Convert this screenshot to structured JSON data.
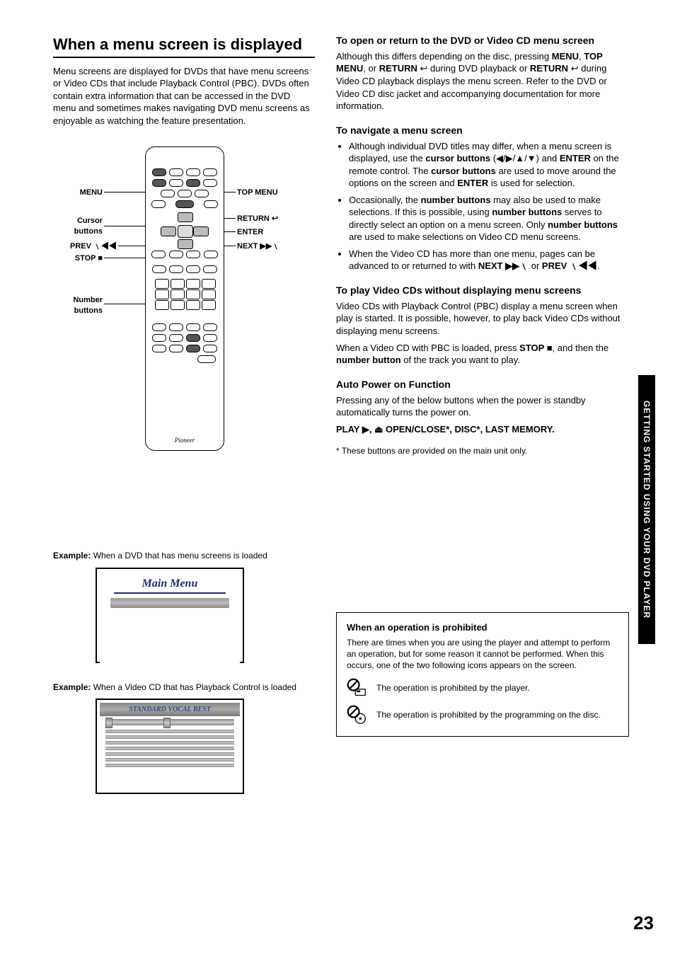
{
  "left": {
    "heading": "When a menu screen is displayed",
    "intro": "Menu screens are displayed for DVDs that have menu screens or Video CDs that include Playback Control (PBC). DVDs often contain extra information that can be accessed in the DVD menu and sometimes makes navigating DVD menu screens as enjoyable as watching the feature presentation.",
    "callouts": {
      "menu": "MENU",
      "cursor": "Cursor\nbuttons",
      "prev": "PREV ﹨◀◀",
      "stop": "STOP ■",
      "numbers": "Number\nbuttons",
      "topmenu": "TOP MENU",
      "return": "RETURN",
      "enter": "ENTER",
      "next": "NEXT ▶▶﹨"
    },
    "brand": "Pioneer",
    "example1_label_bold": "Example:",
    "example1_label_rest": " When a DVD that has menu screens is loaded",
    "mainmenu_title": "Main Menu",
    "example2_label_bold": "Example:",
    "example2_label_rest": " When a Video CD that has Playback Control is loaded",
    "vcd_title": "STANDARD VOCAL BEST"
  },
  "right": {
    "sec1_head": "To open or return to the DVD or Video CD menu screen",
    "sec1_p1a": "Although this differs depending on the disc, pressing ",
    "sec1_menu": "MENU",
    "sec1_p1b": ", ",
    "sec1_topmenu": "TOP MENU",
    "sec1_p1c": ", or ",
    "sec1_return": "RETURN",
    "sec1_p1d": " during DVD playback or ",
    "sec1_return2": "RETURN",
    "sec1_p1e": " during Video CD playback displays the menu screen. Refer to the DVD or Video CD disc jacket and accompanying documentation for more information.",
    "sec2_head": "To navigate a menu screen",
    "sec2_li1a": "Although individual DVD titles may differ, when a menu screen is displayed, use the ",
    "sec2_li1_cb": "cursor buttons",
    "sec2_li1b": " (◀/▶/▲/▼) and ",
    "sec2_li1_enter": "ENTER",
    "sec2_li1c": " on the remote control. The ",
    "sec2_li1_cb2": "cursor buttons",
    "sec2_li1d": " are used to move around the options on the screen and ",
    "sec2_li1_enter2": "ENTER",
    "sec2_li1e": " is used for selection.",
    "sec2_li2a": "Occasionally, the ",
    "sec2_li2_nb": "number buttons",
    "sec2_li2b": " may also be used to make selections. If this is possible, using ",
    "sec2_li2_nb2": "number buttons",
    "sec2_li2c": " serves to directly select an option on a menu screen. Only ",
    "sec2_li2_nb3": "number buttons",
    "sec2_li2d": " are used to make selections on Video CD menu screens.",
    "sec2_li3a": "When the Video CD has more than one menu, pages can be advanced to or returned to with ",
    "sec2_li3_next": "NEXT ▶▶﹨",
    "sec2_li3b": " or ",
    "sec2_li3_prev": "PREV ﹨◀◀",
    "sec2_li3c": ".",
    "sec3_head": "To play Video CDs without displaying menu screens",
    "sec3_p1": "Video CDs with Playback Control (PBC) display a menu screen when play is started. It is possible, however, to play back Video CDs without displaying menu screens.",
    "sec3_p2a": "When a Video CD with PBC is loaded, press ",
    "sec3_stop": "STOP ■",
    "sec3_p2b": ", and then the ",
    "sec3_nb": "number button",
    "sec3_p2c": " of the track you want to play.",
    "sec4_head": "Auto Power on Function",
    "sec4_p1": "Pressing any of the below buttons when the power is standby automatically turns the power on.",
    "sec4_list": "PLAY ▶, ⏏ OPEN/CLOSE*, DISC*, LAST MEMORY.",
    "sec4_note": "* These buttons are provided on the main unit only.",
    "box_head": "When an operation is prohibited",
    "box_p": "There are times when you are using the player and attempt to perform an operation, but for some reason it cannot be performed. When this occurs, one of the two following icons appears on the screen.",
    "box_icon1": "The operation is prohibited by the player.",
    "box_icon2": "The operation is prohibited by the programming on the disc."
  },
  "side_tab": "GETTING STARTED USING YOUR DVD PLAYER",
  "page_number": "23"
}
